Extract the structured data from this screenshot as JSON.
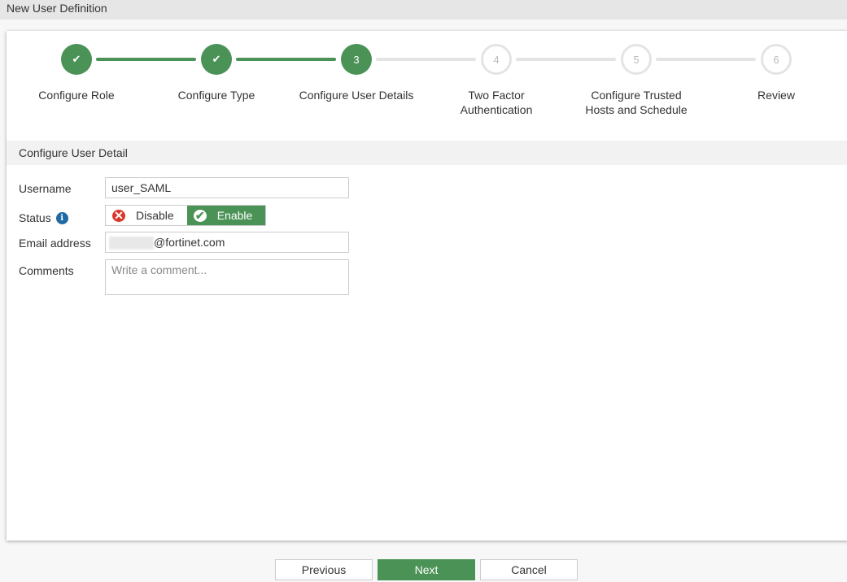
{
  "window_title": "New User Definition",
  "steps": [
    {
      "number": "1",
      "label": "Configure Role",
      "state": "done"
    },
    {
      "number": "2",
      "label": "Configure Type",
      "state": "done"
    },
    {
      "number": "3",
      "label": "Configure User Details",
      "state": "active"
    },
    {
      "number": "4",
      "label": "Two Factor Authentication",
      "state": "todo"
    },
    {
      "number": "5",
      "label": "Configure Trusted Hosts and Schedule",
      "state": "todo"
    },
    {
      "number": "6",
      "label": "Review",
      "state": "todo"
    }
  ],
  "section_title": "Configure User Detail",
  "form": {
    "username_label": "Username",
    "username_value": "user_SAML",
    "status_label": "Status",
    "status_disable": "Disable",
    "status_enable": "Enable",
    "status_selected": "Enable",
    "email_label": "Email address",
    "email_value": "@fortinet.com",
    "comments_label": "Comments",
    "comments_placeholder": "Write a comment..."
  },
  "buttons": {
    "previous": "Previous",
    "next": "Next",
    "cancel": "Cancel"
  },
  "colors": {
    "accent": "#4a9256",
    "error": "#d9372b",
    "info": "#1f6aa5"
  }
}
